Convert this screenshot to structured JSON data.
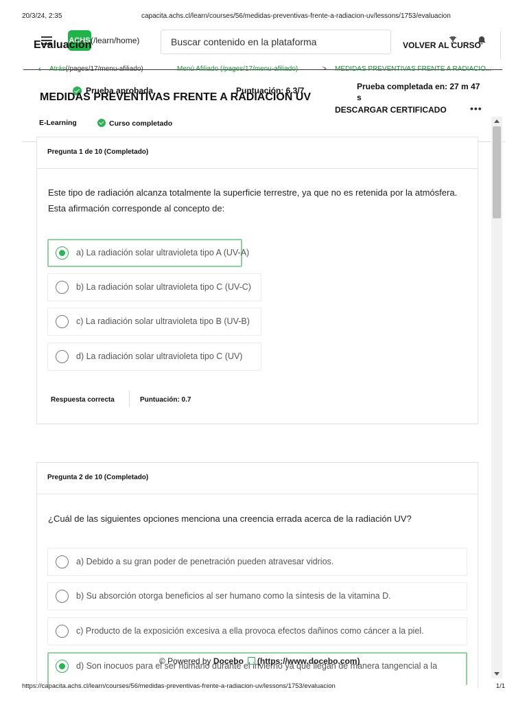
{
  "print": {
    "date": "20/3/24, 2:35",
    "url_top": "capacita.achs.cl/learn/courses/56/medidas-preventivas-frente-a-radiacion-uv/lessons/1753/evaluacion",
    "url_bottom": "https://capacita.achs.cl/learn/courses/56/medidas-preventivas-frente-a-radiacion-uv/lessons/1753/evaluacion",
    "page": "1/1"
  },
  "topbar": {
    "logo_text": "ACHS",
    "logo_link": "(/learn/home)",
    "title": "Evaluación",
    "search_placeholder": "Buscar contenido en la plataforma",
    "back_to_course": "VOLVER AL CURSO",
    "icons": [
      "menu-icon",
      "trophy-icon",
      "bell-icon"
    ]
  },
  "breadcrumb": {
    "back_label": "Atrás",
    "back_link": "(/pages/17/menu-afiliado)",
    "menu": "Menú Afiliado (/pages/17/menu-afiliado)",
    "separator": ">",
    "current": "MEDIDAS PREVENTIVAS FRENTE A RADIACIÓ..."
  },
  "course": {
    "passed": "Prueba aprobada",
    "score": "Puntuación: 6.3/7",
    "completed_in": "Prueba completada en: 27 m 47 s",
    "title": "MEDIDAS PREVENTIVAS FRENTE A RADIACION UV",
    "download": "DESCARGAR CERTIFICADO",
    "more": "•••",
    "type": "E-Learning",
    "status": "Curso completado"
  },
  "questions": [
    {
      "header": "Pregunta 1 de 10  (Completado)",
      "text": "Este tipo de radiación alcanza totalmente la superficie terrestre, ya que no es retenida por la atmósfera. Esta afirmación corresponde al concepto de:",
      "options": [
        {
          "label": "a) La radiación solar ultravioleta tipo A (UV-A)",
          "selected": true
        },
        {
          "label": "b) La radiación solar ultravioleta tipo C (UV-C)",
          "selected": false
        },
        {
          "label": "c) La radiación solar ultravioleta tipo B (UV-B)",
          "selected": false
        },
        {
          "label": "d) La radiación solar ultravioleta tipo C (UV)",
          "selected": false
        }
      ],
      "result": "Respuesta correcta",
      "points": "Puntuación: 0.7"
    },
    {
      "header": "Pregunta 2 de 10  (Completado)",
      "text": "¿Cuál de las siguientes opciones menciona una creencia errada acerca de la radiación UV?",
      "options": [
        {
          "label": "a) Debido a su gran poder de penetración pueden atravesar vidrios.",
          "selected": false
        },
        {
          "label": "b) Su absorción otorga beneficios al ser humano como la síntesis de la vitamina D.",
          "selected": false
        },
        {
          "label": "c) Producto de la exposición excesiva a ella provoca efectos dañinos como cáncer a la piel.",
          "selected": false
        },
        {
          "label": "d) Son inocuos para el ser humano durante el invierno ya que llegan de manera tangencial a la",
          "selected": true
        }
      ]
    }
  ],
  "footer": {
    "powered_prefix": "© Powered by",
    "brand": "Docebo",
    "brand_link": "(https://www.docebo.com)"
  },
  "colors": {
    "accent": "#2eb157",
    "selected_border": "#8fd19e",
    "link_green": "#1e8a3a"
  }
}
